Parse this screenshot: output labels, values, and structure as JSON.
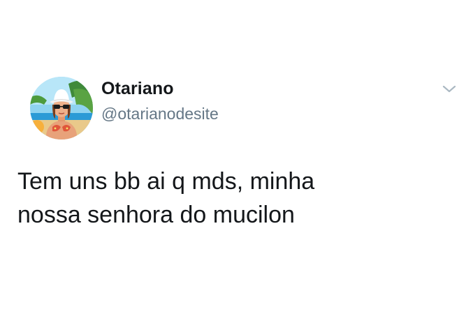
{
  "tweet": {
    "author": {
      "display_name": "Otariano",
      "handle": "@otarianodesite",
      "avatar_icon": "profile-photo-beach-avatar"
    },
    "menu_icon": "chevron-down-icon",
    "text": "Tem uns bb ai q mds, minha\nnossa senhora do mucilon"
  },
  "colors": {
    "name": "#14171a",
    "handle": "#657786",
    "chevron": "#aab8c2",
    "background": "#ffffff"
  }
}
